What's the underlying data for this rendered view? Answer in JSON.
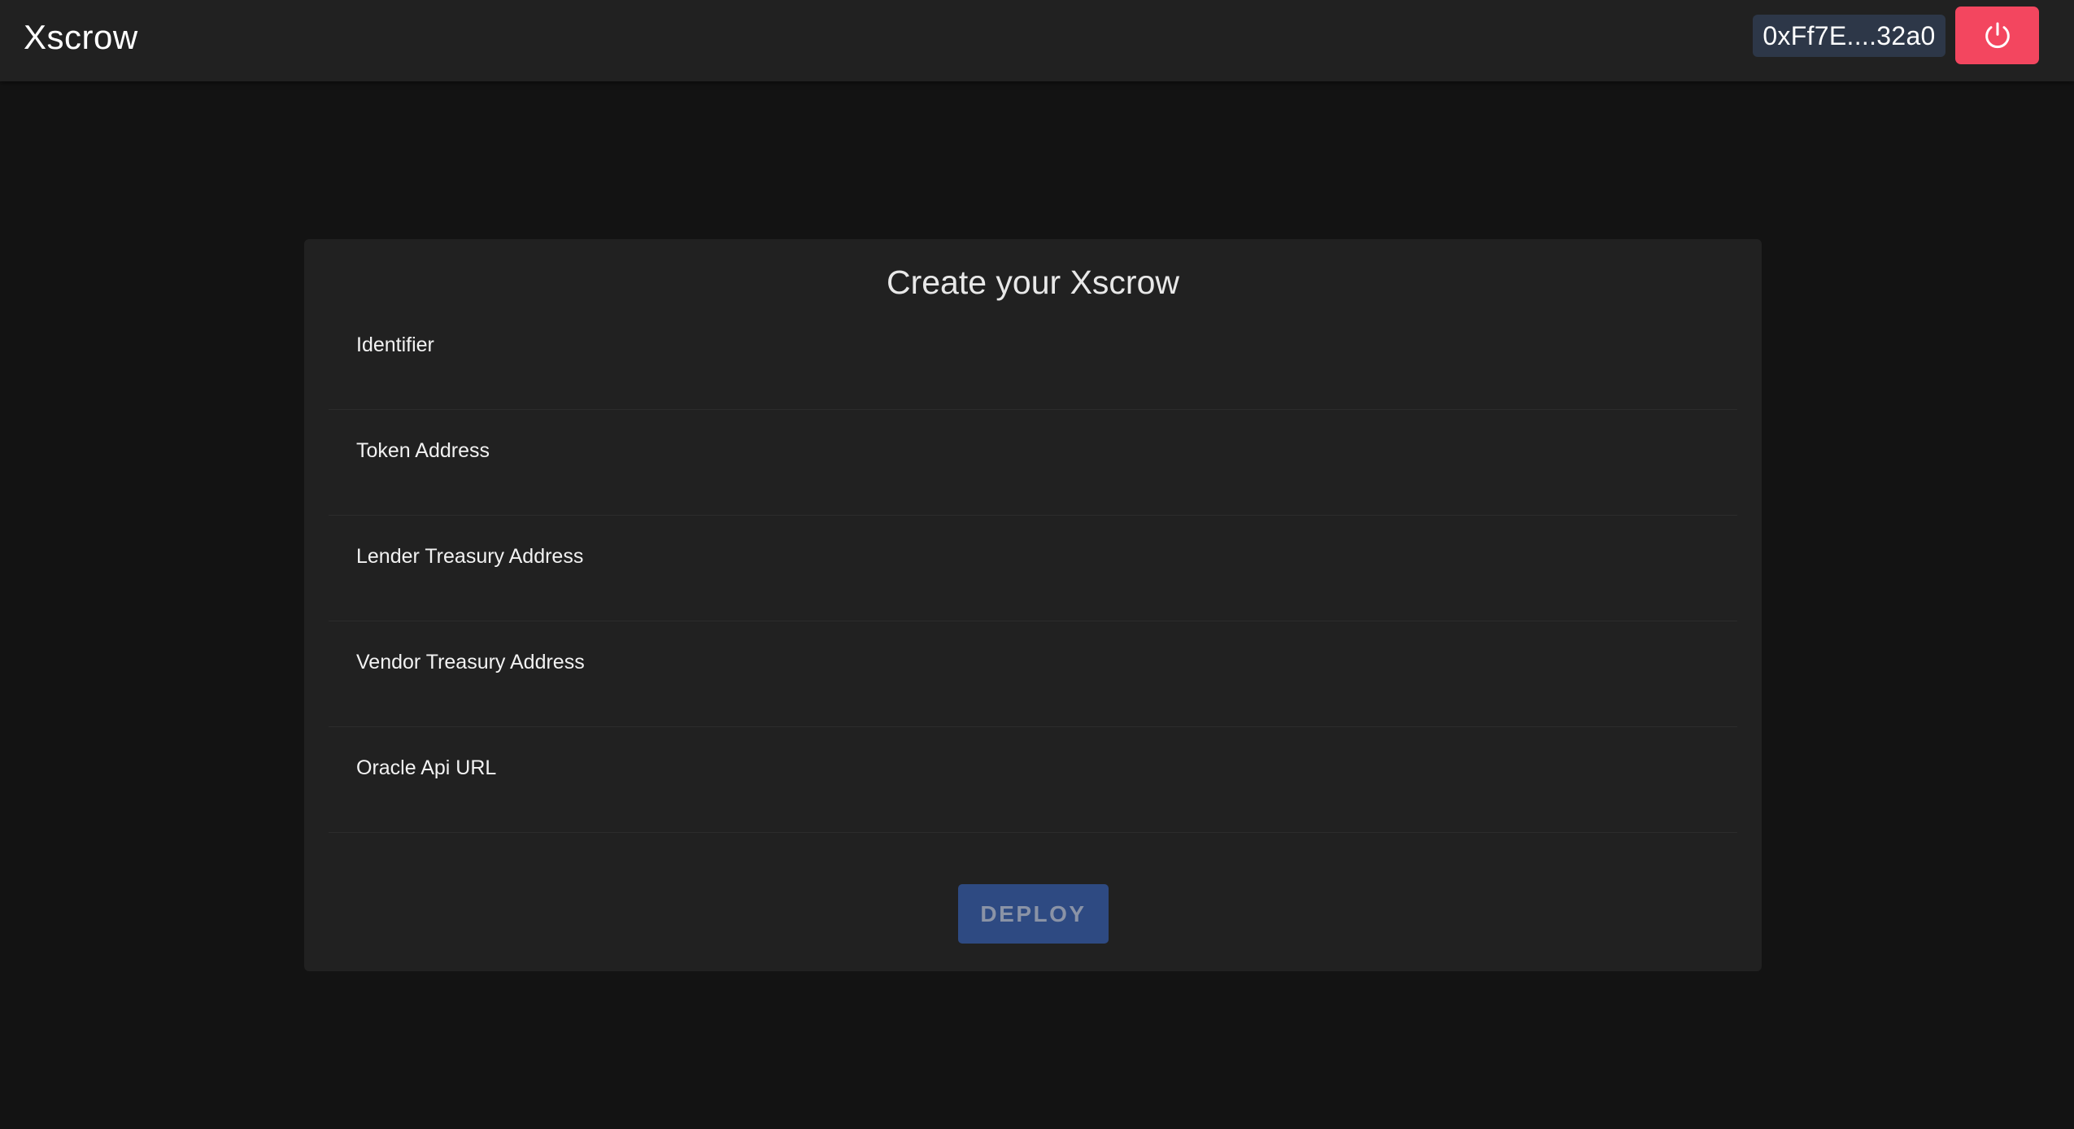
{
  "app": {
    "brand": "Xscrow"
  },
  "header": {
    "wallet_address": "0xFf7E....32a0",
    "power_icon": "power-icon",
    "power_button_color": "#f3465f"
  },
  "form": {
    "title": "Create your Xscrow",
    "fields": [
      {
        "label": "Identifier",
        "value": "",
        "placeholder": ""
      },
      {
        "label": "Token Address",
        "value": "",
        "placeholder": ""
      },
      {
        "label": "Lender Treasury Address",
        "value": "",
        "placeholder": ""
      },
      {
        "label": "Vendor Treasury Address",
        "value": "",
        "placeholder": ""
      },
      {
        "label": "Oracle Api URL",
        "value": "",
        "placeholder": ""
      }
    ],
    "deploy_label": "DEPLOY",
    "deploy_color": "#2e4a82"
  }
}
